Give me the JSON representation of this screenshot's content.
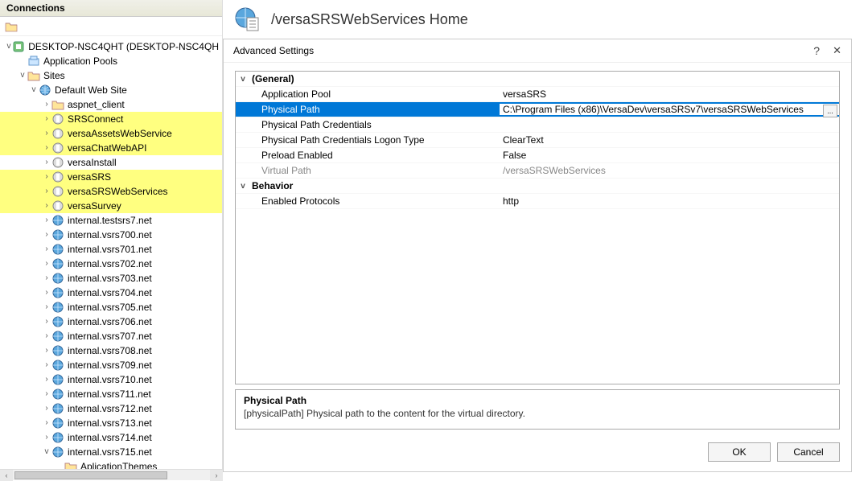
{
  "left_panel": {
    "title": "Connections",
    "tree": {
      "server": "DESKTOP-NSC4QHT (DESKTOP-NSC4QH",
      "app_pools": "Application Pools",
      "sites": "Sites",
      "default_site": "Default Web Site",
      "aspnet_client": "aspnet_client",
      "highlighted": [
        "SRSConnect",
        "versaAssetsWebService",
        "versaChatWebAPI"
      ],
      "versaInstall": "versaInstall",
      "highlighted2": [
        "versaSRS",
        "versaSRSWebServices",
        "versaSurvey"
      ],
      "internals": [
        "internal.testsrs7.net",
        "internal.vsrs700.net",
        "internal.vsrs701.net",
        "internal.vsrs702.net",
        "internal.vsrs703.net",
        "internal.vsrs704.net",
        "internal.vsrs705.net",
        "internal.vsrs706.net",
        "internal.vsrs707.net",
        "internal.vsrs708.net",
        "internal.vsrs709.net",
        "internal.vsrs710.net",
        "internal.vsrs711.net",
        "internal.vsrs712.net",
        "internal.vsrs713.net",
        "internal.vsrs714.net",
        "internal.vsrs715.net"
      ],
      "last_child": "AplicationThemes"
    }
  },
  "header": {
    "title": "/versaSRSWebServices Home"
  },
  "dialog": {
    "title": "Advanced Settings",
    "help": "?",
    "sections": {
      "general": "(General)",
      "behavior": "Behavior"
    },
    "props": {
      "app_pool": {
        "label": "Application Pool",
        "value": "versaSRS"
      },
      "phys_path": {
        "label": "Physical Path",
        "value": "C:\\Program Files (x86)\\VersaDev\\versaSRSv7\\versaSRSWebServices"
      },
      "phys_cred": {
        "label": "Physical Path Credentials",
        "value": ""
      },
      "logon_type": {
        "label": "Physical Path Credentials Logon Type",
        "value": "ClearText"
      },
      "preload": {
        "label": "Preload Enabled",
        "value": "False"
      },
      "virtual": {
        "label": "Virtual Path",
        "value": "/versaSRSWebServices"
      },
      "protocols": {
        "label": "Enabled Protocols",
        "value": "http"
      }
    },
    "desc": {
      "title": "Physical Path",
      "text": "[physicalPath] Physical path to the content for the virtual directory."
    },
    "buttons": {
      "ok": "OK",
      "cancel": "Cancel"
    },
    "browse_label": "..."
  }
}
